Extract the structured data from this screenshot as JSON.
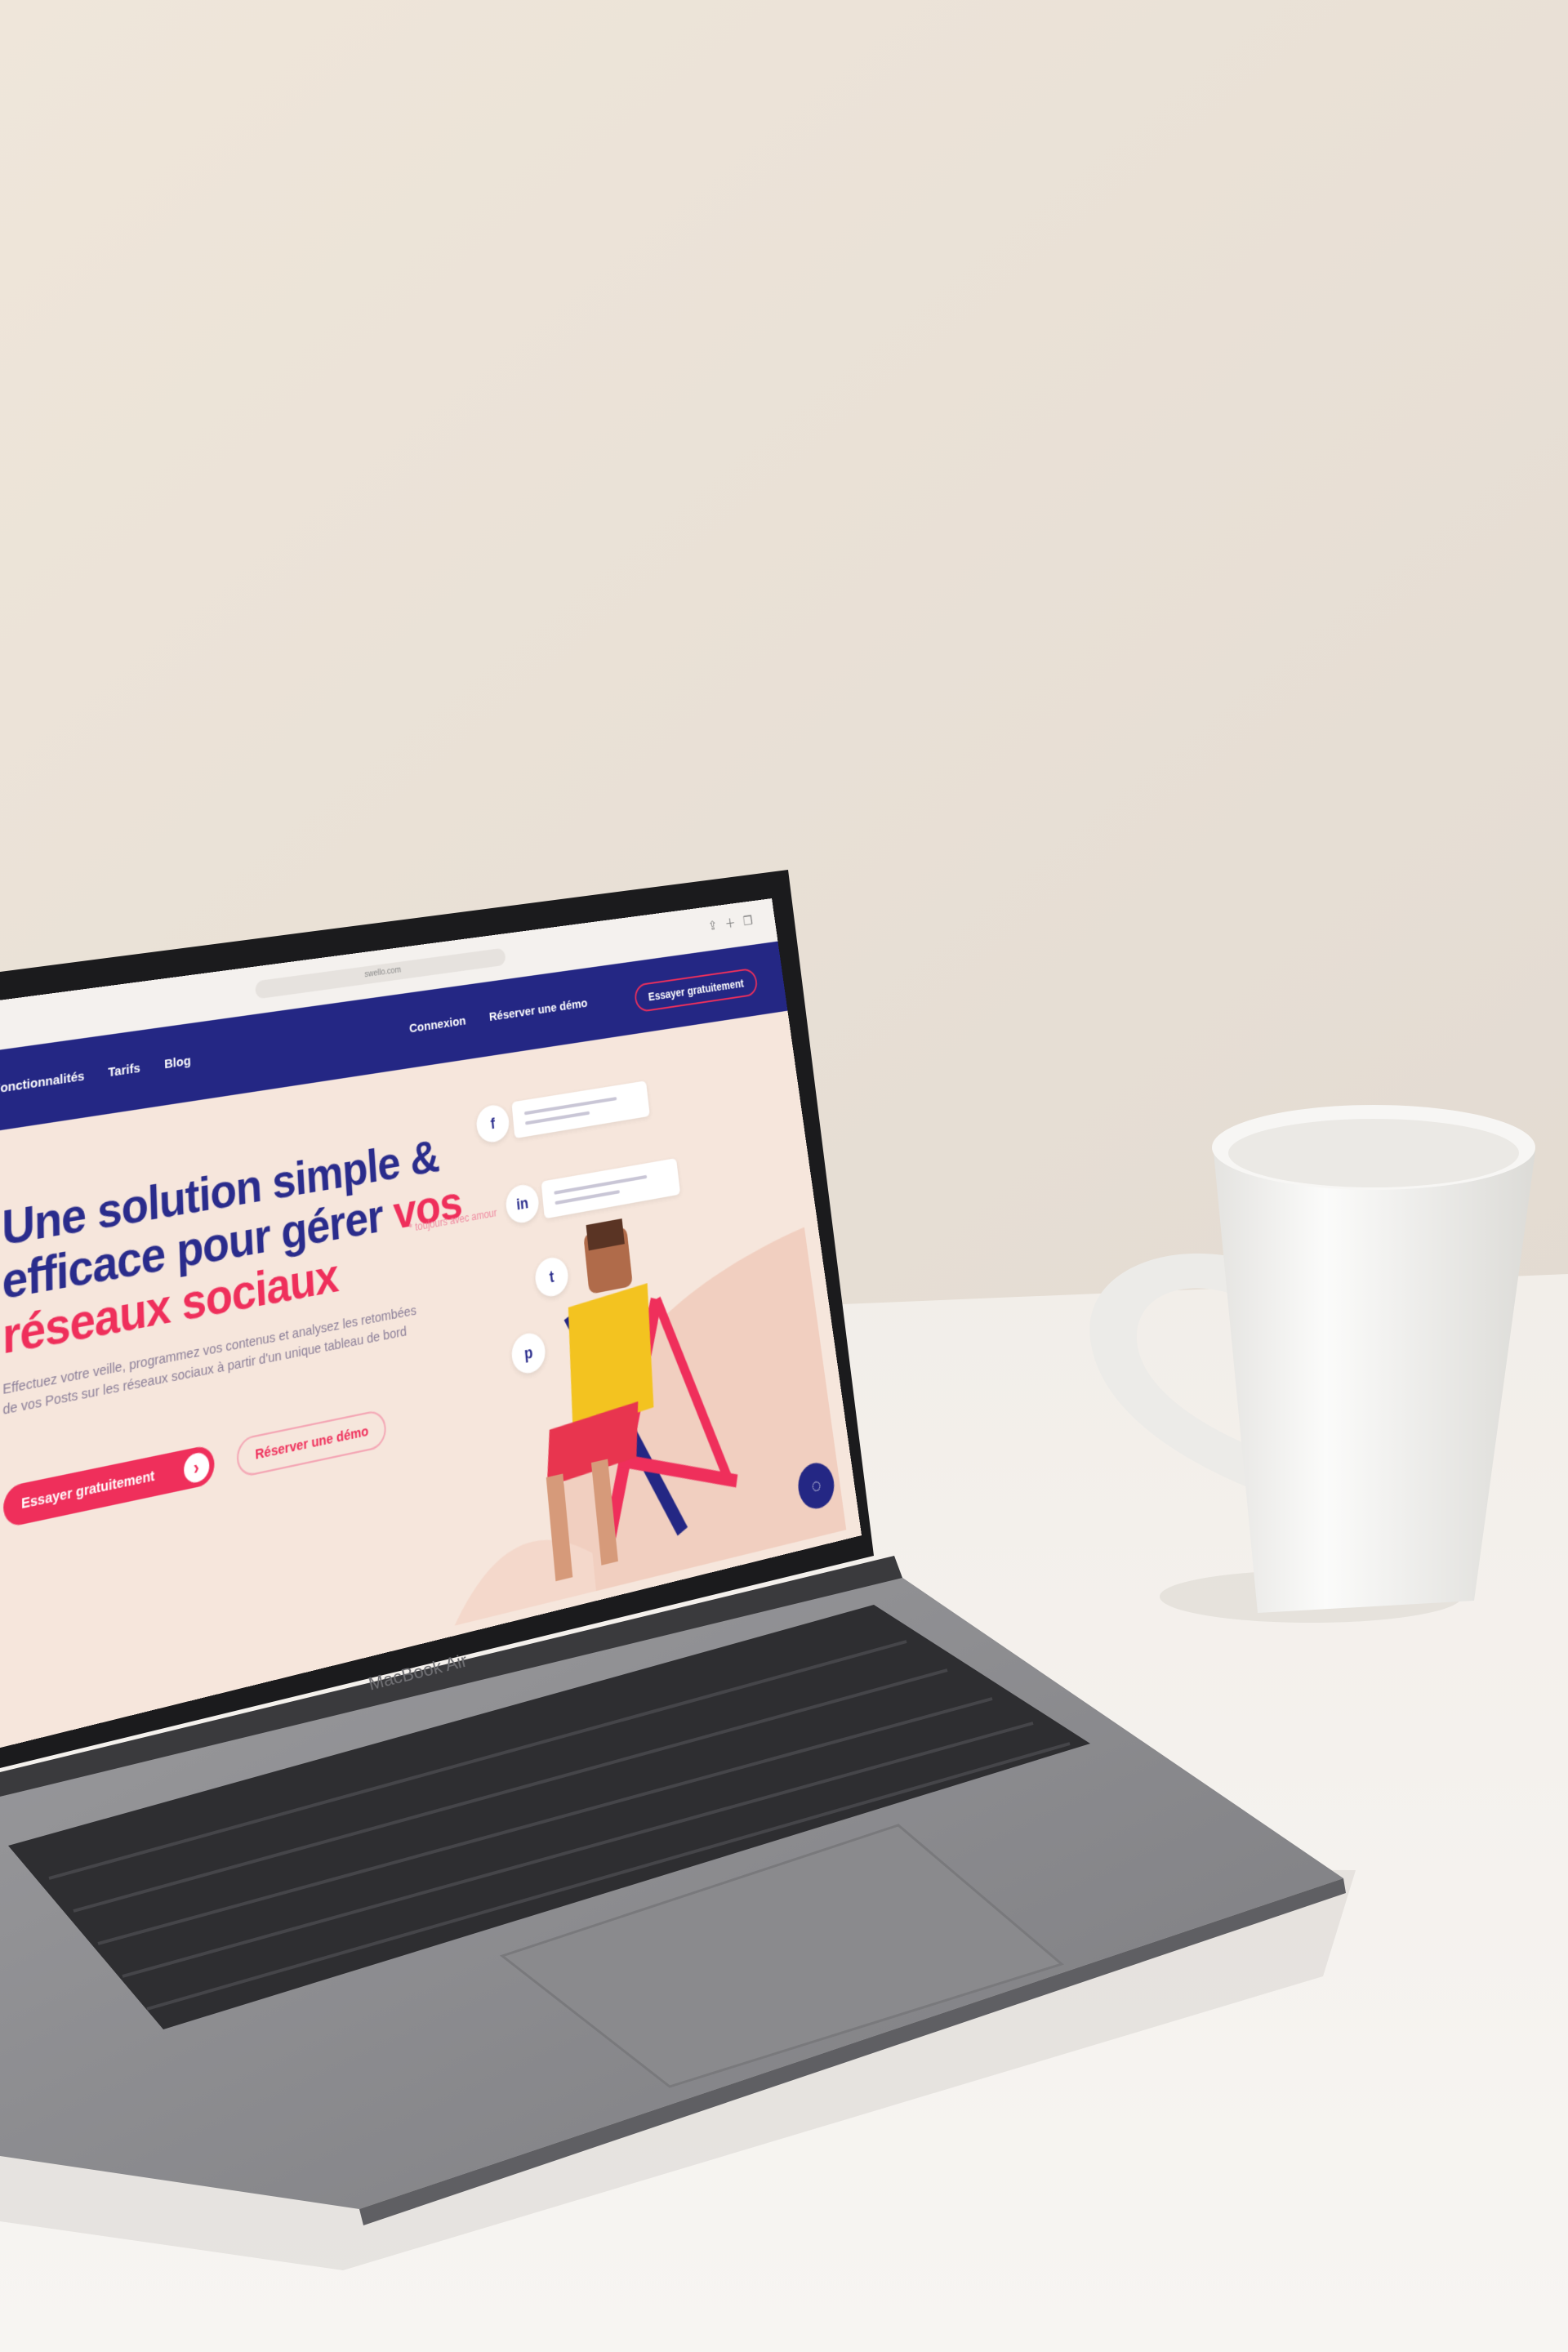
{
  "laptop": {
    "model": "MacBook Air"
  },
  "website": {
    "url": "swello.com",
    "nav": {
      "items": [
        "Fonctionnalités",
        "Tarifs",
        "Blog"
      ],
      "login": "Connexion",
      "demo": "Réserver une démo",
      "cta": "Essayer gratuitement"
    },
    "hero": {
      "title_line1": "Une solution simple &",
      "title_line2": "efficace pour gérer",
      "title_accent_inline": "vos",
      "title_accent_line": "réseaux sociaux",
      "tagline": "* toujours avec amour",
      "subtitle": "Effectuez votre veille, programmez vos contenus et analysez les retombées de vos Posts sur les réseaux sociaux à partir d'un unique tableau de bord",
      "primary_button": "Essayer gratuitement",
      "secondary_button": "Réserver une démo"
    },
    "social_icons": [
      "f",
      "in",
      "t",
      "p"
    ]
  },
  "colors": {
    "wall": "#ede4d9",
    "table": "#f3f0ec",
    "brand_navy": "#242784",
    "brand_pink": "#ef2f5b",
    "laptop_body": "#8f8f91",
    "mug": "#f5f4f1"
  }
}
